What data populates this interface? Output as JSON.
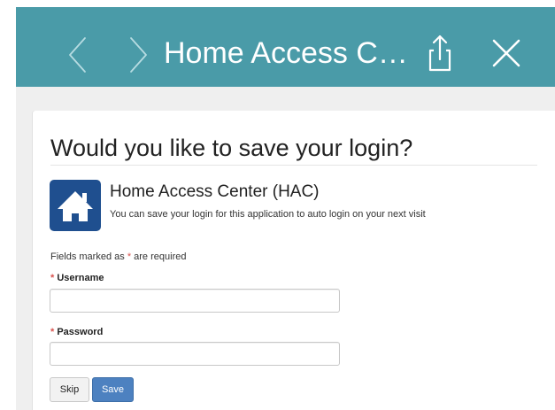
{
  "topbar": {
    "title": "Home Access C…",
    "background_color": "#4a9ba8",
    "back_icon": "chevron-left-icon",
    "forward_icon": "chevron-right-icon",
    "share_icon": "share-icon",
    "close_icon": "close-icon"
  },
  "dialog": {
    "heading": "Would you like to save your login?",
    "app": {
      "icon": "home-icon",
      "icon_color": "#1f4f8f",
      "name": "Home Access Center (HAC)",
      "description": "You can save your login for this application to auto login on your next visit"
    },
    "required_note": {
      "before": "Fields marked as ",
      "star": "*",
      "after": " are required"
    },
    "fields": {
      "username": {
        "star": "*",
        "label": "Username",
        "value": "",
        "placeholder": ""
      },
      "password": {
        "star": "*",
        "label": "Password",
        "value": "",
        "placeholder": ""
      }
    },
    "buttons": {
      "skip": "Skip",
      "save": "Save"
    },
    "colors": {
      "required_star": "#d9534f",
      "save_button": "#4d81c0"
    }
  }
}
